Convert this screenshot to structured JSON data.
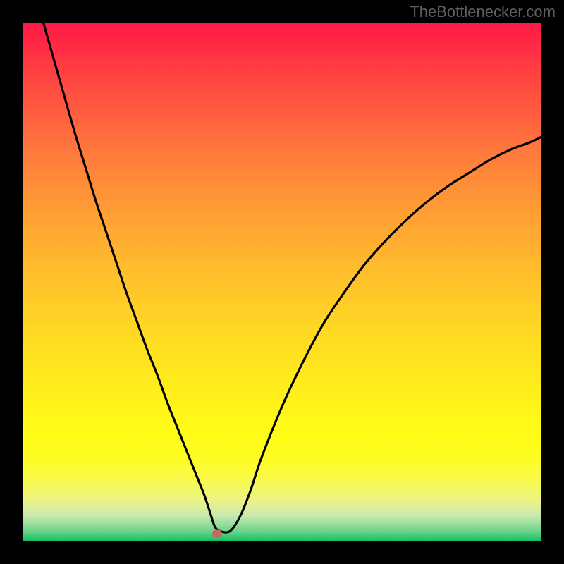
{
  "attribution": "TheBottlenecker.com",
  "chart_data": {
    "type": "line",
    "title": "",
    "xlabel": "",
    "ylabel": "",
    "xlim": [
      0,
      100
    ],
    "ylim": [
      0,
      100
    ],
    "series": [
      {
        "name": "bottleneck-curve",
        "x": [
          4,
          6,
          8,
          10,
          12,
          14,
          16,
          18,
          20,
          22,
          24,
          26,
          28,
          30,
          32,
          33,
          34,
          35,
          36,
          37,
          38,
          40,
          42,
          44,
          46,
          50,
          54,
          58,
          62,
          66,
          70,
          74,
          78,
          82,
          86,
          90,
          94,
          98,
          100
        ],
        "y": [
          100,
          93,
          86,
          79,
          72.5,
          66,
          60,
          54,
          48,
          42.5,
          37,
          32,
          26.5,
          21.5,
          16.5,
          14,
          11.5,
          9,
          6,
          3,
          2,
          2,
          5,
          10,
          16,
          26,
          34.5,
          42,
          48,
          53.5,
          58,
          62,
          65.5,
          68.5,
          71,
          73.5,
          75.5,
          77,
          78
        ]
      }
    ],
    "marker": {
      "x": 37.5,
      "y": 1.5
    },
    "background_gradient": {
      "top": "#ff1946",
      "mid": "#ffd126",
      "bottom": "#0cc05f"
    }
  }
}
